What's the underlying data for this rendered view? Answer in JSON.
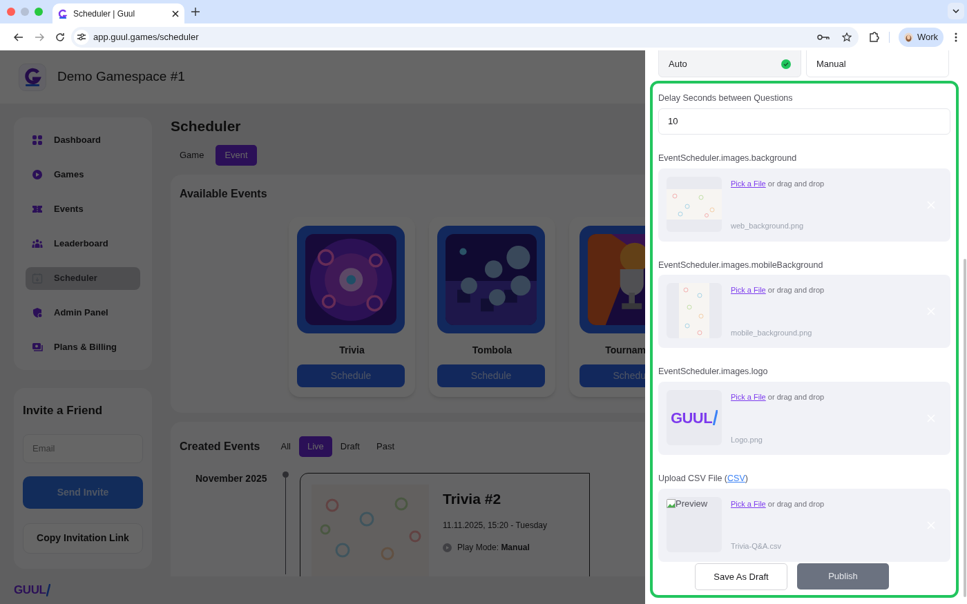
{
  "browser": {
    "tab_title": "Scheduler | Guul",
    "url": "app.guul.games/scheduler",
    "profile": "Work"
  },
  "app": {
    "gamespace": "Demo Gamespace #1",
    "sidebar": [
      {
        "label": "Dashboard",
        "selected": false
      },
      {
        "label": "Games",
        "selected": false
      },
      {
        "label": "Events",
        "selected": false
      },
      {
        "label": "Leaderboard",
        "selected": false
      },
      {
        "label": "Scheduler",
        "selected": true
      },
      {
        "label": "Admin Panel",
        "selected": false
      },
      {
        "label": "Plans & Billing",
        "selected": false
      }
    ],
    "invite": {
      "title": "Invite a Friend",
      "email_placeholder": "Email",
      "send": "Send Invite",
      "copy": "Copy Invitation Link"
    },
    "footer_logo": "GUUL",
    "page_title": "Scheduler",
    "mode_tabs": [
      {
        "label": "Game",
        "selected": false
      },
      {
        "label": "Event",
        "selected": true
      }
    ],
    "available_events": {
      "title": "Available Events",
      "games": [
        {
          "name": "Trivia",
          "button": "Schedule",
          "kind": "trivia",
          "cut_off": false
        },
        {
          "name": "Tombola",
          "button": "Schedule",
          "kind": "tombola",
          "cut_off": false
        },
        {
          "name": "Tournam",
          "button": "Schedu",
          "kind": "trophy",
          "cut_off": true
        }
      ]
    },
    "created_events": {
      "title": "Created Events",
      "filters": [
        {
          "label": "All",
          "selected": false
        },
        {
          "label": "Live",
          "selected": true
        },
        {
          "label": "Draft",
          "selected": false
        },
        {
          "label": "Past",
          "selected": false
        }
      ],
      "month": "November 2025",
      "event": {
        "title": "Trivia #2",
        "date": "11.11.2025, 15:20 - Tuesday",
        "play_mode": "Play Mode: **Manual**"
      }
    }
  },
  "drawer": {
    "play_modes": [
      {
        "label": "Auto",
        "selected": true
      },
      {
        "label": "Manual",
        "selected": false
      }
    ],
    "delay": {
      "label": "Delay Seconds between Questions",
      "value": "10"
    },
    "uploads": [
      {
        "label": "EventScheduler.images.background",
        "link": "Pick a File",
        "hint": "or drag and drop",
        "filename": "web_background.png",
        "preview": {
          "kind": "pattern"
        }
      },
      {
        "label": "EventScheduler.images.mobileBackground",
        "link": "Pick a File",
        "hint": "or drag and drop",
        "filename": "mobile_background.png",
        "preview": {
          "kind": "tall-pattern"
        }
      },
      {
        "label": "EventScheduler.images.logo",
        "link": "Pick a File",
        "hint": "or drag and drop",
        "filename": "Logo.png",
        "preview": {
          "kind": "logo",
          "text": "GUUL"
        }
      },
      {
        "label": "Upload CSV File (",
        "label_link": "CSV",
        "label_end": ")",
        "link": "Pick a File",
        "hint": "or drag and drop",
        "filename": "Trivia-Q&A.csv",
        "preview": {
          "kind": "broken",
          "text": "Preview"
        }
      }
    ],
    "save_draft": "Save As Draft",
    "publish": {
      "label": "Publish",
      "disabled": true
    }
  }
}
